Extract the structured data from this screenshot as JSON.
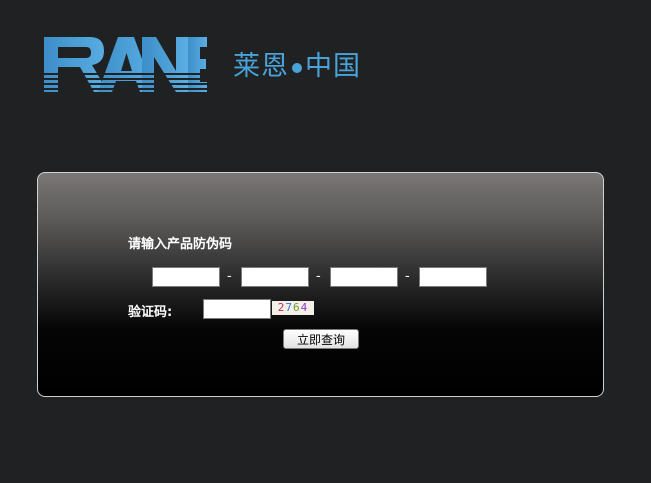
{
  "brand": {
    "logo_text": "RANE",
    "cn_part1": "莱恩",
    "cn_part2": "中国",
    "accent_color": "#4aa3d8"
  },
  "form": {
    "title": "请输入产品防伪码",
    "code_fields": [
      {
        "value": ""
      },
      {
        "value": ""
      },
      {
        "value": ""
      },
      {
        "value": ""
      }
    ],
    "separator": "-",
    "captcha_label": "验证码:",
    "captcha_value": "",
    "captcha_digits": [
      "2",
      "7",
      "6",
      "4"
    ],
    "submit_label": "立即查询"
  }
}
